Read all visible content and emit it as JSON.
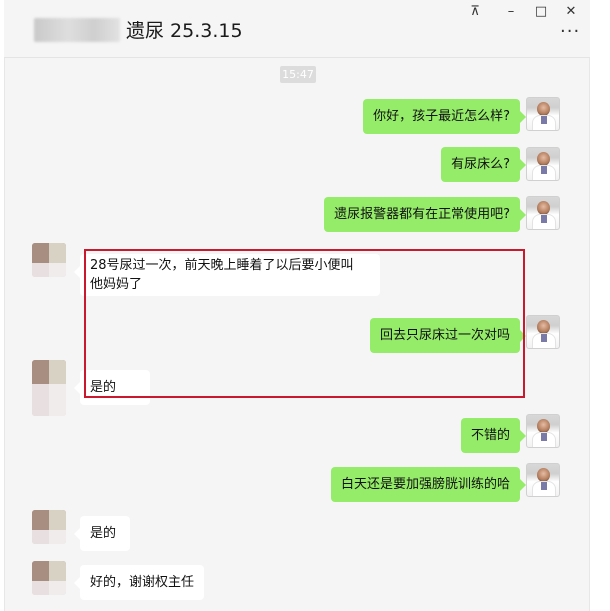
{
  "title": "遗尿 25.3.15",
  "window_controls": {
    "pin": "⊼",
    "minimize": "–",
    "maximize": "□",
    "close": "✕",
    "more": "..."
  },
  "timestamp": "15:47",
  "messages": [
    {
      "side": "sent",
      "lines": [
        "你好，孩子最近怎么样?"
      ]
    },
    {
      "side": "sent",
      "lines": [
        "有尿床么?"
      ]
    },
    {
      "side": "sent",
      "lines": [
        "遗尿报警器都有在正常使用吧?"
      ]
    },
    {
      "side": "recv",
      "lines": [
        "28号尿过一次，前天晚上睡着了以后要小便叫",
        "他妈妈了"
      ]
    },
    {
      "side": "sent",
      "lines": [
        "回去只尿床过一次对吗"
      ]
    },
    {
      "side": "recv",
      "lines": [
        "是的"
      ]
    },
    {
      "side": "sent",
      "lines": [
        "不错的"
      ]
    },
    {
      "side": "sent",
      "lines": [
        "白天还是要加强膀胱训练的哈"
      ]
    },
    {
      "side": "recv",
      "lines": [
        "是的"
      ]
    },
    {
      "side": "recv",
      "lines": [
        "好的，谢谢权主任"
      ]
    }
  ],
  "colors": {
    "sent_bubble": "#95ec69",
    "recv_bubble": "#ffffff",
    "highlight": "#c8192e",
    "background": "#f5f5f5"
  }
}
